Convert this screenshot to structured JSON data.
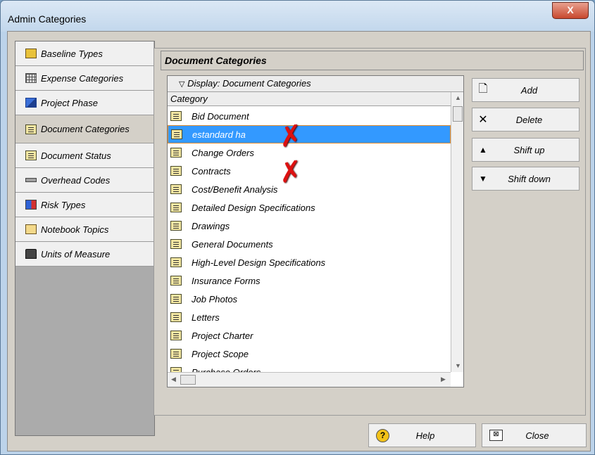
{
  "window": {
    "title": "Admin Categories",
    "close_glyph": "X"
  },
  "sidebar": {
    "items": [
      {
        "label": "Baseline Types",
        "icon": "baseline-icon"
      },
      {
        "label": "Expense Categories",
        "icon": "calculator-icon"
      },
      {
        "label": "Project Phase",
        "icon": "phase-icon"
      },
      {
        "label": "Document Categories",
        "icon": "document-icon",
        "selected": true
      },
      {
        "label": "Document Status",
        "icon": "document-icon"
      },
      {
        "label": "Overhead Codes",
        "icon": "overhead-icon"
      },
      {
        "label": "Risk Types",
        "icon": "risk-icon"
      },
      {
        "label": "Notebook Topics",
        "icon": "notebook-icon"
      },
      {
        "label": "Units of Measure",
        "icon": "units-icon"
      }
    ]
  },
  "main": {
    "section_title": "Document Categories",
    "display_label": "Display: Document Categories",
    "display_glyph": "▽",
    "column_header": "Category",
    "rows": [
      "Bid Document",
      "estandard ha",
      "Change Orders",
      "Contracts",
      "Cost/Benefit Analysis",
      "Detailed Design Specifications",
      "Drawings",
      "General Documents",
      "High-Level Design Specifications",
      "Insurance Forms",
      "Job Photos",
      "Letters",
      "Project Charter",
      "Project Scope",
      "Purchase Orders"
    ],
    "selected_row_index": 1
  },
  "buttons": {
    "add": {
      "label": "Add",
      "glyph": "🗋"
    },
    "delete": {
      "label": "Delete",
      "glyph": "✕"
    },
    "shift_up": {
      "label": "Shift up",
      "glyph": "▲"
    },
    "shift_down": {
      "label": "Shift down",
      "glyph": "▼"
    }
  },
  "footer": {
    "help": {
      "label": "Help",
      "glyph": "?"
    },
    "close": {
      "label": "Close",
      "glyph": "⊠"
    }
  },
  "annotations": {
    "mark_glyph": "✗",
    "color": "#d11111"
  },
  "colors": {
    "selection": "#3399ff",
    "selection_border": "#e08a2a",
    "title_bar": "#c2d7ec",
    "close_button": "#c8482e"
  }
}
